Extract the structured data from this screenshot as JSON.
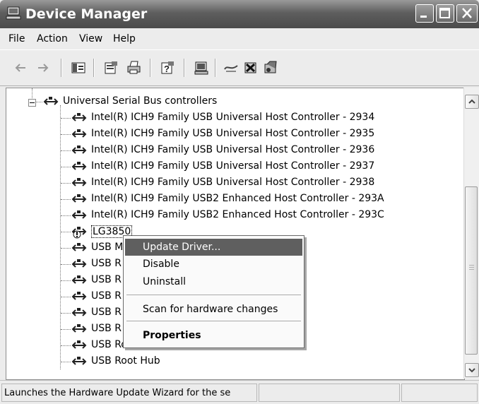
{
  "window": {
    "title": "Device Manager",
    "icon": "computer-icon"
  },
  "menu": [
    "File",
    "Action",
    "View",
    "Help"
  ],
  "toolbar": {
    "icons": [
      "back-icon",
      "forward-icon",
      "show-hide-tree-icon",
      "properties-icon",
      "print-icon",
      "help-icon",
      "scan-hardware-icon",
      "update-driver-icon",
      "uninstall-icon",
      "disable-icon"
    ]
  },
  "tree": {
    "group_label": "Universal Serial Bus controllers",
    "items": [
      "Intel(R) ICH9 Family USB Universal Host Controller - 2934",
      "Intel(R) ICH9 Family USB Universal Host Controller - 2935",
      "Intel(R) ICH9 Family USB Universal Host Controller - 2936",
      "Intel(R) ICH9 Family USB Universal Host Controller - 2937",
      "Intel(R) ICH9 Family USB Universal Host Controller - 2938",
      "Intel(R) ICH9 Family USB2 Enhanced Host Controller - 293A",
      "Intel(R) ICH9 Family USB2 Enhanced Host Controller - 293C",
      "LG3850",
      "USB M",
      "USB R",
      "USB R",
      "USB R",
      "USB R",
      "USB R",
      "USB Root Hub",
      "USB Root Hub"
    ]
  },
  "context_menu": {
    "items": [
      "Update Driver...",
      "Disable",
      "Uninstall",
      "Scan for hardware changes",
      "Properties"
    ]
  },
  "status": {
    "text": "Launches the Hardware Update Wizard for the se"
  }
}
